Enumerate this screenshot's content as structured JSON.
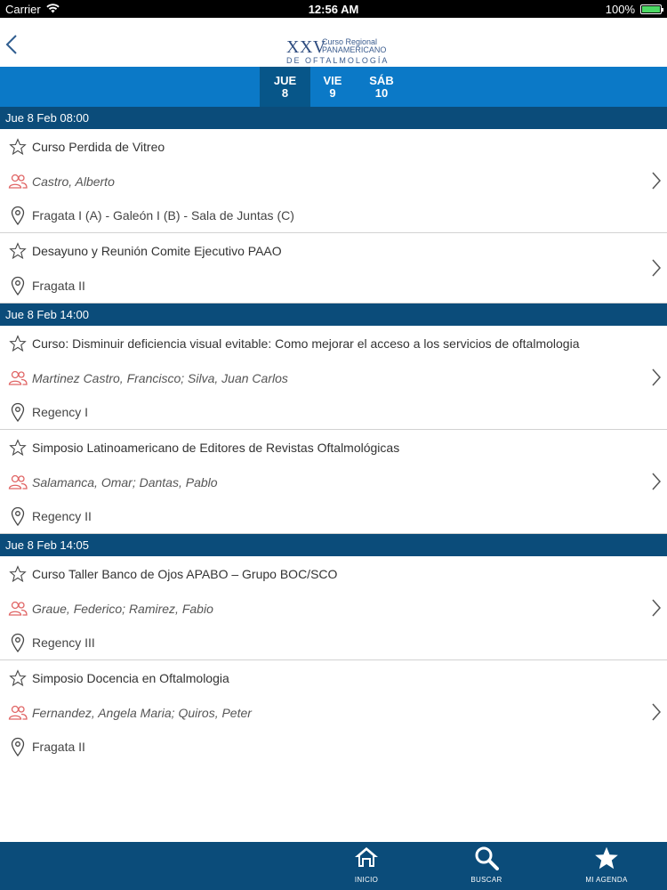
{
  "status_bar": {
    "carrier": "Carrier",
    "time": "12:56 AM",
    "battery": "100%",
    "battery_level": 1.0
  },
  "header": {
    "logo_roman": "XXV",
    "logo_line1": "Curso Regional",
    "logo_line2": "PANAMERICANO",
    "logo_line3": "DE OFTALMOLOGÍA"
  },
  "day_tabs": [
    {
      "day": "JUE",
      "date": "8",
      "active": true
    },
    {
      "day": "VIE",
      "date": "9",
      "active": false
    },
    {
      "day": "SÁB",
      "date": "10",
      "active": false
    }
  ],
  "sections": [
    {
      "header": "Jue 8 Feb 08:00",
      "events": [
        {
          "title": "Curso Perdida de Vitreo",
          "speakers": "Castro, Alberto",
          "room": "Fragata I (A) - Galeón I (B) - Sala de Juntas (C)"
        },
        {
          "title": "Desayuno y Reunión Comite Ejecutivo PAAO",
          "speakers": "",
          "room": "Fragata II"
        }
      ]
    },
    {
      "header": "Jue 8 Feb 14:00",
      "events": [
        {
          "title": "Curso: Disminuir deficiencia visual evitable: Como mejorar el acceso a los servicios de oftalmologia",
          "speakers": "Martinez Castro, Francisco; Silva, Juan Carlos",
          "room": "Regency I"
        },
        {
          "title": "Simposio Latinoamericano de Editores de Revistas Oftalmológicas",
          "speakers": "Salamanca, Omar; Dantas, Pablo",
          "room": "Regency II"
        }
      ]
    },
    {
      "header": "Jue 8 Feb 14:05",
      "events": [
        {
          "title": "Curso Taller Banco de Ojos APABO – Grupo BOC/SCO",
          "speakers": "Graue, Federico; Ramirez, Fabio",
          "room": "Regency III"
        },
        {
          "title": "Simposio Docencia en Oftalmologia",
          "speakers": "Fernandez, Angela Maria; Quiros, Peter",
          "room": "Fragata II"
        }
      ]
    }
  ],
  "bottom_nav": {
    "inicio": "INICIO",
    "buscar": "BUSCAR",
    "agenda": "MI AGENDA"
  },
  "colors": {
    "tab_bar": "#0b79c7",
    "tab_active": "#075689",
    "section_header": "#0b4c7a",
    "speaker_icon": "#e06666"
  },
  "icons": [
    "back-chevron-icon",
    "star-outline-icon",
    "people-icon",
    "location-pin-icon",
    "chevron-right-icon",
    "home-icon",
    "search-icon",
    "star-filled-icon"
  ]
}
